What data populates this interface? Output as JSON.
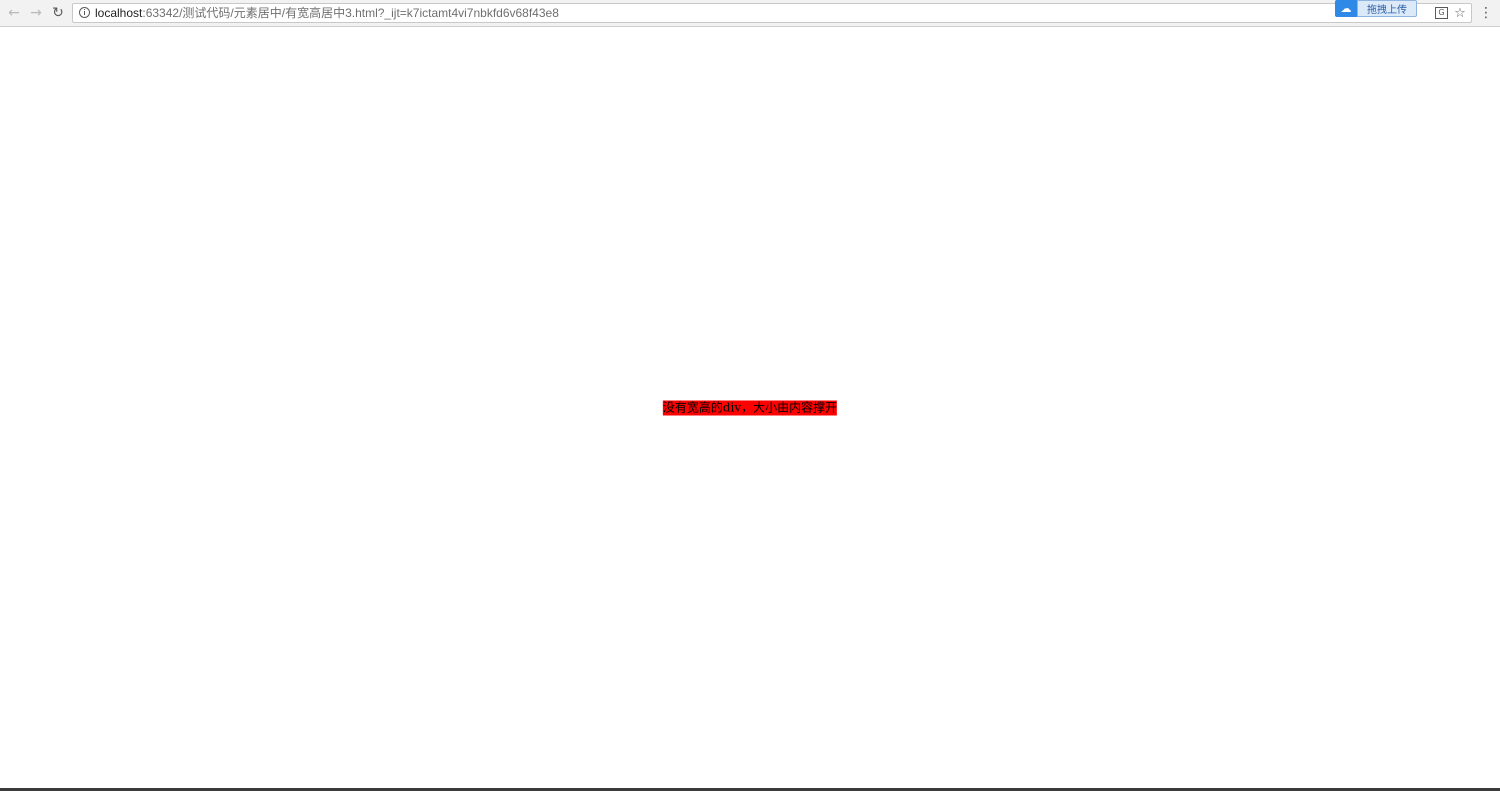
{
  "browser": {
    "url_host": "localhost",
    "url_rest": ":63342/测试代码/元素居中/有宽高居中3.html?_ijt=k7ictamt4vi7nbkfd6v68f43e8",
    "extension_label": "拖拽上传",
    "icons": {
      "back": "arrow-left-icon",
      "forward": "arrow-right-icon",
      "reload": "reload-icon",
      "info": "info-icon",
      "translate": "translate-icon",
      "bookmark": "star-icon",
      "menu": "kebab-menu-icon"
    }
  },
  "page": {
    "box_text": "没有宽高的div，大小由内容撑开",
    "box_color": "#ff0000",
    "background": "#ffffff"
  }
}
